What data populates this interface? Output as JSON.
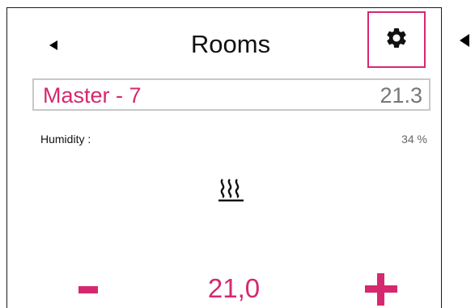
{
  "header": {
    "back_icon": "back-arrow-icon",
    "title": "Rooms",
    "settings_icon": "gear-icon"
  },
  "room": {
    "name": "Master - 7",
    "current_temp": "21.3"
  },
  "humidity": {
    "label": "Humidity :",
    "value": "34 %"
  },
  "mode_icon": "heating-icon",
  "setpoint": {
    "minus_icon": "minus-icon",
    "value": "21,0",
    "plus_icon": "plus-icon"
  },
  "colors": {
    "accent": "#d6286f",
    "text": "#111111",
    "muted": "#777777",
    "box_border": "#c8c8c8"
  }
}
